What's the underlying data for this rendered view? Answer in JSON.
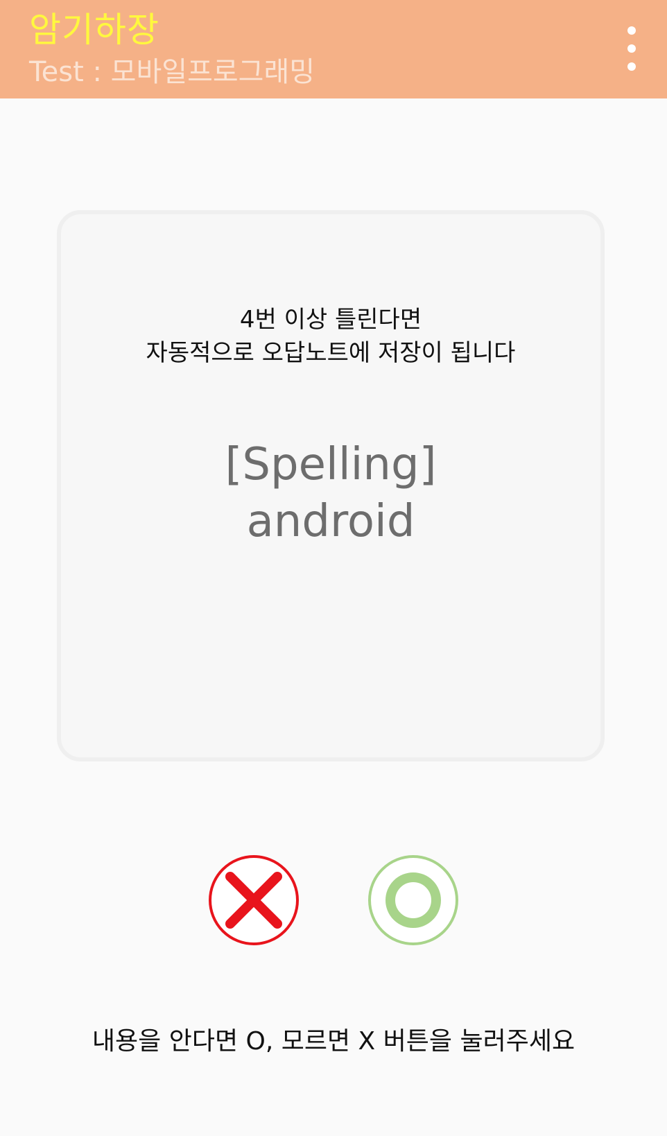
{
  "appbar": {
    "title": "암기하장",
    "subtitle": "Test : 모바일프로그래밍",
    "menu_icon": "more-vert-icon",
    "background": "#f5b187",
    "title_color": "#fff83e"
  },
  "card": {
    "notice_line1": "4번 이상 틀린다면",
    "notice_line2": "자동적으로 오답노트에 저장이 됩니다",
    "category": "[Spelling]",
    "word": "android"
  },
  "buttons": {
    "dont_know_icon": "x-mark-icon",
    "dont_know_color": "#e8141c",
    "know_icon": "o-circle-icon",
    "know_color": "#a8d48a"
  },
  "instruction": "내용을 안다면 O, 모르면 X 버튼을 눌러주세요"
}
